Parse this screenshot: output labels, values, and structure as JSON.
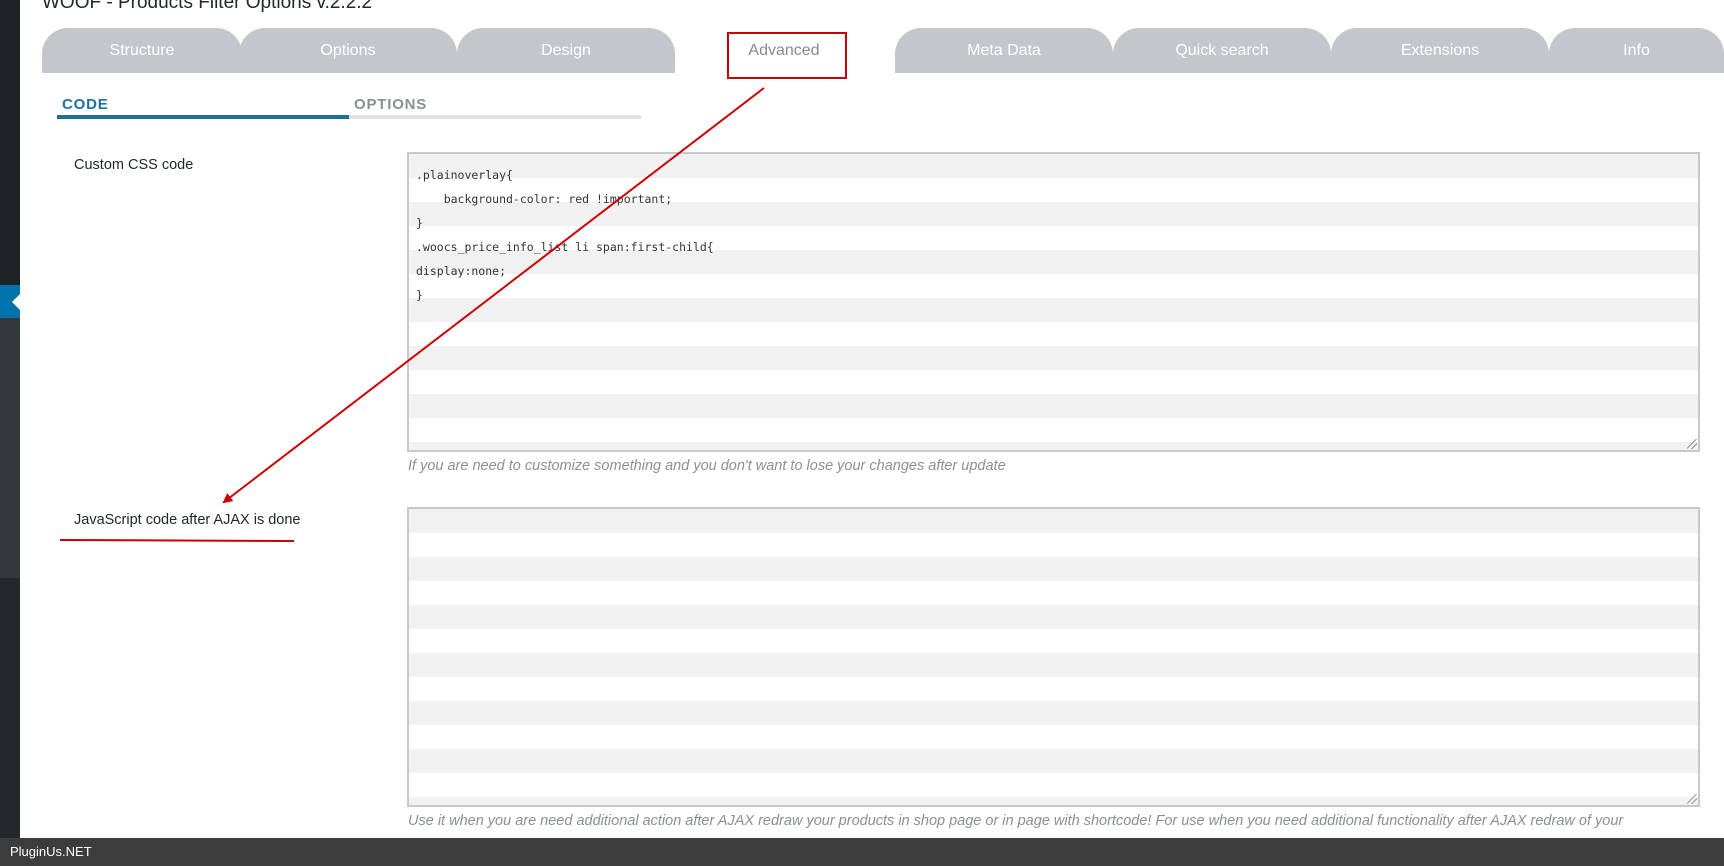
{
  "page": {
    "title": "WOOF - Products Filter Options v.2.2.2"
  },
  "main_tabs": [
    {
      "label": "Structure",
      "active": false
    },
    {
      "label": "Options",
      "active": false
    },
    {
      "label": "Design",
      "active": false
    },
    {
      "label": "Advanced",
      "active": true
    },
    {
      "label": "Meta Data",
      "active": false
    },
    {
      "label": "Quick search",
      "active": false
    },
    {
      "label": "Extensions",
      "active": false
    },
    {
      "label": "Info",
      "active": false
    }
  ],
  "sub_tabs": [
    {
      "label": "CODE",
      "active": true
    },
    {
      "label": "OPTIONS",
      "active": false
    }
  ],
  "fields": {
    "custom_css": {
      "label": "Custom CSS code",
      "lines": [
        ".plainoverlay{",
        "    background-color: red !important;",
        "}",
        ".woocs_price_info_list li span:first-child{",
        "display:none;",
        "}"
      ],
      "help": "If you are need to customize something and you don't want to lose your changes after update"
    },
    "js_after_ajax": {
      "label": "JavaScript code after AJAX is done",
      "lines": [],
      "help": "Use it when you are need additional action after AJAX redraw your products in shop page or in page with shortcode! For use when you need additional functionality after AJAX redraw of your"
    }
  },
  "footer": {
    "credit": "PluginUs.NET"
  },
  "colors": {
    "annotation": "#cc0000",
    "tab_inactive": "#c4c6cb",
    "sub_tab_active": "#1e6fa0",
    "admin_active": "#0073aa"
  },
  "icons": {
    "admin_marker": "arrow-left-icon",
    "resize": "resize-grip-icon"
  }
}
